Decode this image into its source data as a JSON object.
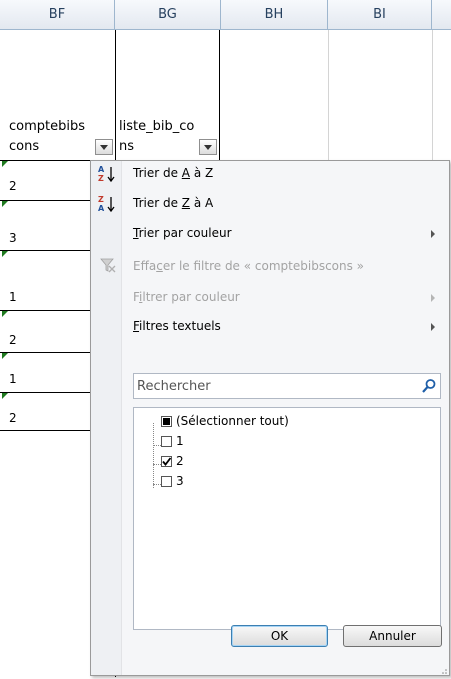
{
  "columns": [
    "BF",
    "BG",
    "BH",
    "BI"
  ],
  "headers": {
    "bf_line1": "comptebibs",
    "bf_line2": "cons",
    "bg_line1": "liste_bib_co",
    "bg_line2": "ns"
  },
  "values": [
    "2",
    "3",
    "1",
    "2",
    "1",
    "2"
  ],
  "menu": {
    "sort_az": {
      "pre": "Trier de ",
      "key": "A",
      "post": " à Z"
    },
    "sort_za": {
      "pre": "Trier de ",
      "key": "Z",
      "post": " à A"
    },
    "sort_color": {
      "key": "T",
      "post": "rier par couleur"
    },
    "clear_filter": {
      "pre": "Effa",
      "key": "c",
      "post": "er le filtre de « comptebibscons »"
    },
    "filter_color": {
      "pre": "F",
      "key": "i",
      "post": "ltrer par couleur"
    },
    "text_filters": {
      "key": "F",
      "post": "iltres textuels"
    },
    "search_placeholder": "Rechercher",
    "select_all": "(Sélectionner tout)",
    "items": [
      {
        "label": "1",
        "checked": false
      },
      {
        "label": "2",
        "checked": true
      },
      {
        "label": "3",
        "checked": false
      }
    ],
    "ok": "OK",
    "cancel": "Annuler"
  }
}
